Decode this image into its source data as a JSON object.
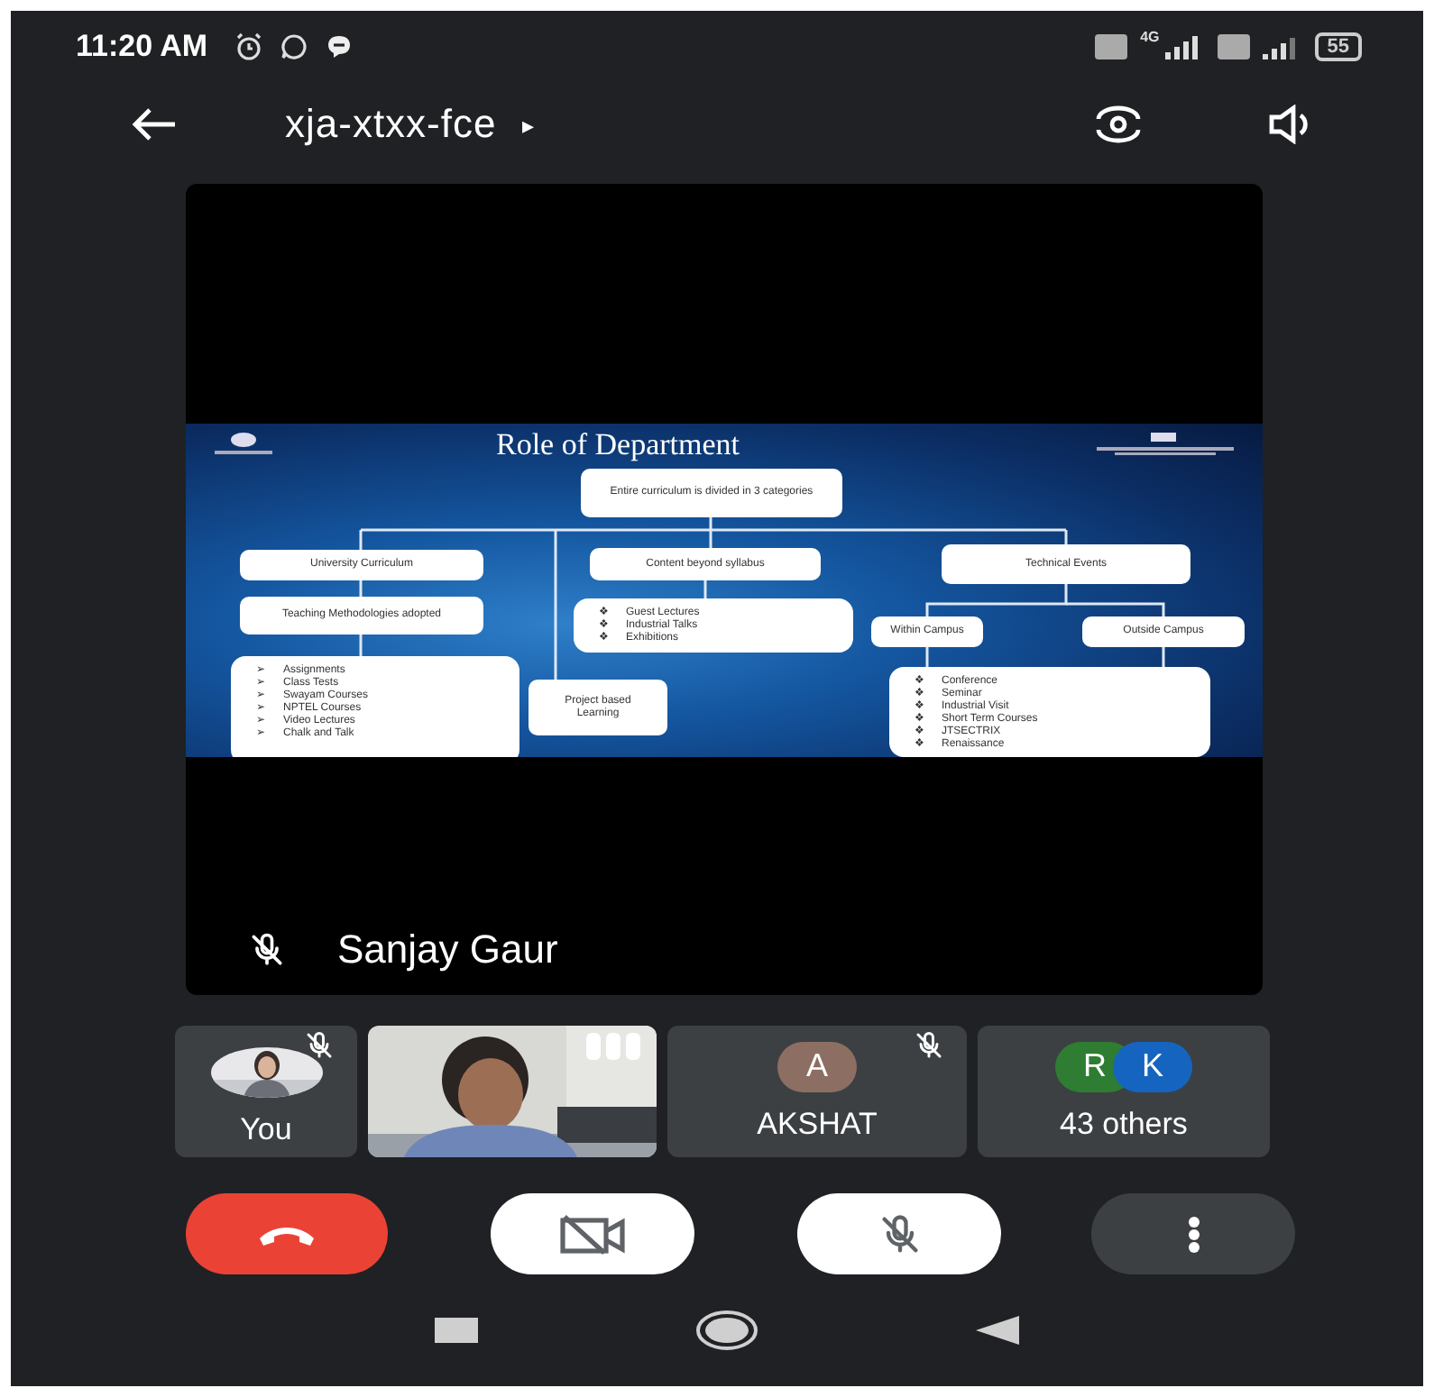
{
  "status_bar": {
    "time": "11:20 AM",
    "network": "4G",
    "battery": "55"
  },
  "top_bar": {
    "meeting_code": "xja-xtxx-fce",
    "caret": "▸"
  },
  "stage": {
    "presenter": "Sanjay Gaur",
    "muted": true,
    "slide": {
      "title": "Role of Department",
      "nodes": [
        {
          "kind": "box",
          "text": "Entire curriculum is divided in 3 categories"
        },
        {
          "kind": "box",
          "text": "University Curriculum"
        },
        {
          "kind": "box",
          "text": "Teaching Methodologies adopted"
        },
        {
          "kind": "list",
          "bullet": "➢",
          "items": [
            "Assignments",
            "Class Tests",
            "Swayam Courses",
            "NPTEL Courses",
            "Video Lectures",
            "Chalk and Talk"
          ]
        },
        {
          "kind": "box",
          "text": "Project based Learning"
        },
        {
          "kind": "box",
          "text": "Content beyond syllabus"
        },
        {
          "kind": "list",
          "bullet": "❖",
          "items": [
            "Guest Lectures",
            "Industrial Talks",
            "Exhibitions"
          ]
        },
        {
          "kind": "box",
          "text": "Technical Events"
        },
        {
          "kind": "box",
          "text": "Within Campus"
        },
        {
          "kind": "box",
          "text": "Outside Campus"
        },
        {
          "kind": "list",
          "bullet": "❖",
          "items": [
            "Conference",
            "Seminar",
            "Industrial Visit",
            "Short Term Courses",
            "JTSECTRIX",
            "Renaissance"
          ]
        }
      ]
    }
  },
  "participants": [
    {
      "name": "You",
      "muted": true
    },
    {
      "kind": "video",
      "speaking": true
    },
    {
      "kind": "initial",
      "initials": [
        {
          "letter": "A",
          "color": "#8d6e63"
        }
      ],
      "name": "AKSHAT",
      "muted": true
    },
    {
      "kind": "initial",
      "initials": [
        {
          "letter": "R",
          "color": "#2e7d32"
        },
        {
          "letter": "K",
          "color": "#1565c0"
        }
      ],
      "name": "43 others",
      "muted": false
    }
  ],
  "controls": {
    "camera_on": false,
    "mic_on": false
  }
}
